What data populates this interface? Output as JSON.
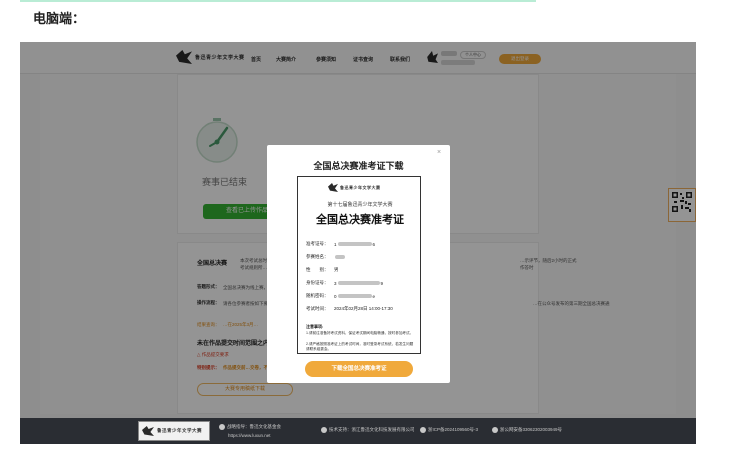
{
  "section_title": "电脑端：",
  "nav": {
    "logo_text": "鲁迅青少年文学大赛",
    "items": [
      "首页",
      "大赛简介",
      "参赛须知",
      "证书查询",
      "联系我们"
    ],
    "user_center": "个人中心",
    "logout": "退出登录"
  },
  "page": {
    "ended_text": "赛事已结束",
    "view_button": "查看已上传作品",
    "final_label": "全国总决赛",
    "final_desc": "本次考试总时长为…时，考试规则所…",
    "right_desc": "…示评节，随后2小时的正式作答时",
    "row1_label": "答题形式：",
    "row1_text": "全国总决赛为线上赛，采…",
    "row2_label": "操作流程：",
    "row2_text": "请各位参赛者按如下要求…处。",
    "row2_right": "…在公众号发布的第三期全国总决赛通",
    "row3_label": "结果查询：",
    "row3_text": "…在2025年3月…",
    "range_title": "未在作品提交时间范围之内",
    "submit_link": "作品提交要求",
    "tip_label": "特别提示：",
    "tip_text": "作品提交前…交卷，不…",
    "outline_button": "大赛专用稿纸下载"
  },
  "footer": {
    "logo_text": "鲁迅青少年文学大赛",
    "item1": "战略指导：鲁迅文化基金会",
    "url": "https://www.luxun.net",
    "item2": "技术支持：浙江鲁迅文化科技发展有限公司",
    "item3": "浙ICP备2024109560号-3",
    "item4": "浙公网安备33062302003949号"
  },
  "modal": {
    "title": "全国总决赛准考证下载",
    "close": "×",
    "download_button": "下载全国总决赛准考证"
  },
  "ticket": {
    "logo_text": "鲁迅青少年文学大赛",
    "subtitle": "第十七届鲁迅青少年文学大赛",
    "title": "全国总决赛准考证",
    "fields": [
      {
        "label": "准考证号：",
        "prefix": "1",
        "suffix": "6"
      },
      {
        "label": "参赛姓名：",
        "prefix": "",
        "suffix": ""
      },
      {
        "label": "性　　别：",
        "prefix": "男",
        "suffix": ""
      },
      {
        "label": "身份证号：",
        "prefix": "3",
        "suffix": "9"
      },
      {
        "label": "随机密码：",
        "prefix": "0",
        "suffix": "e"
      },
      {
        "label": "考试时间：",
        "prefix": "2024年02月28日 14:00-17:30",
        "suffix": ""
      }
    ],
    "notice_title": "注意事项:",
    "notice_1": "1.请前往准备好考试资料，保证考试期间电脑畅通，按时参加考试。",
    "notice_2": "2.请严格按照准考证上的考试时间，准时登录考试系统，若发生问题请联系组委会。"
  }
}
